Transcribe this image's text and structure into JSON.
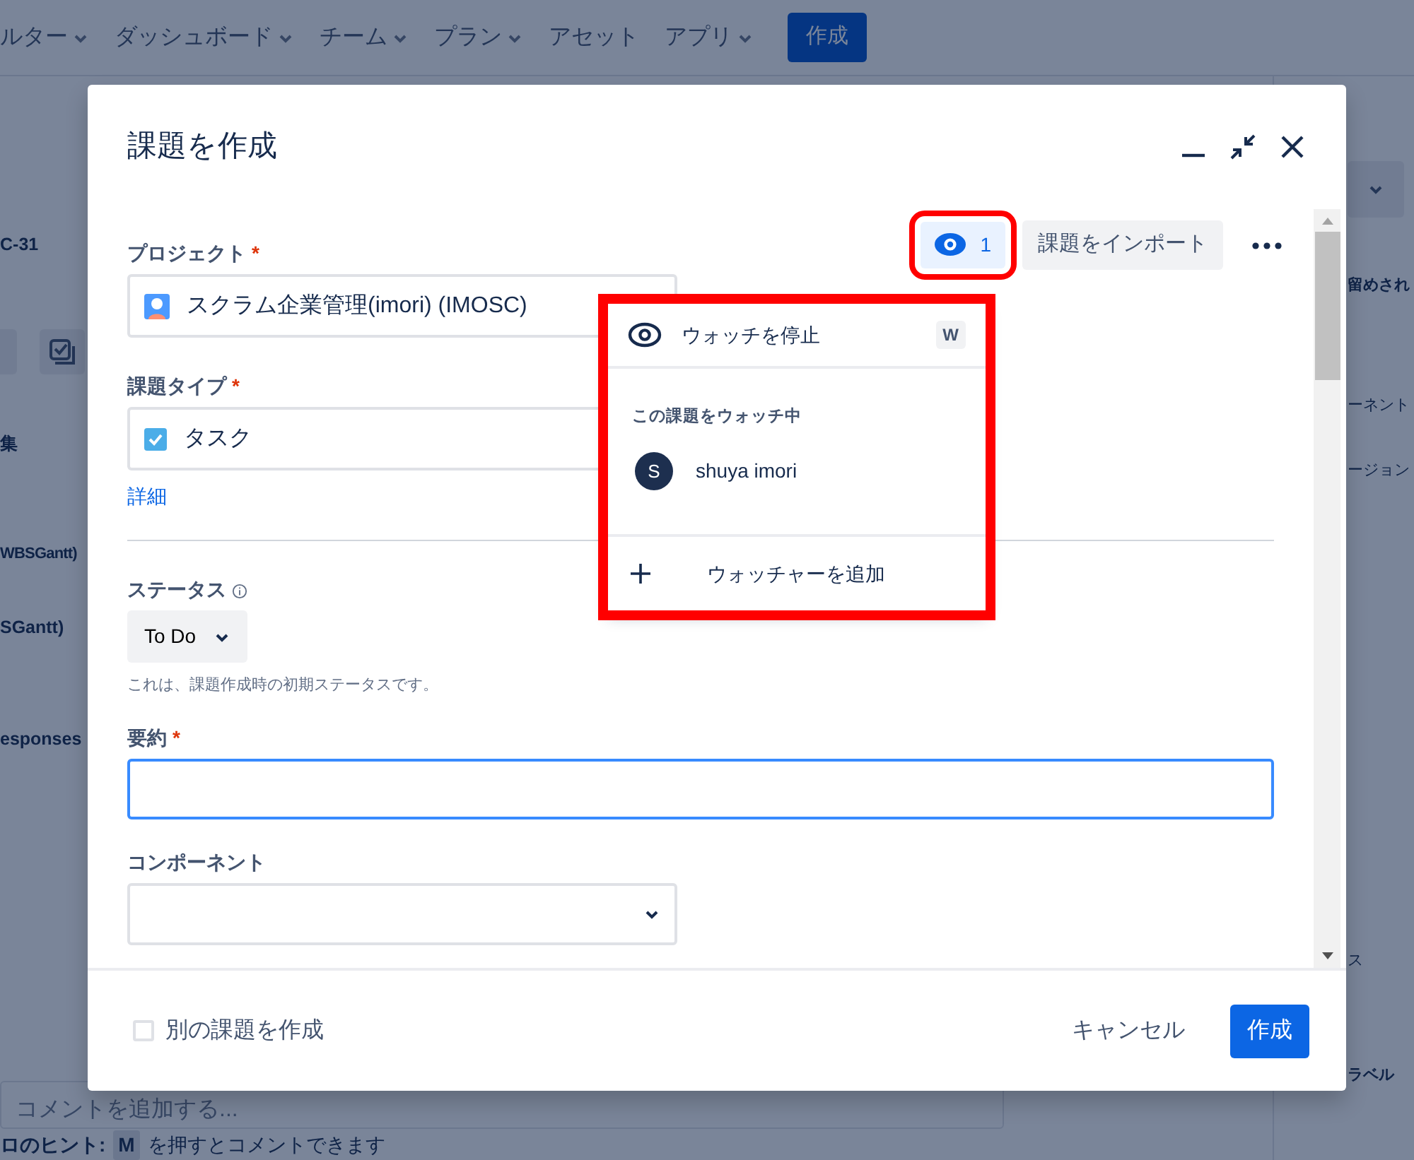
{
  "background": {
    "nav_items": [
      {
        "label": "ルター",
        "dropdown": true
      },
      {
        "label": "ダッシュボード",
        "dropdown": true
      },
      {
        "label": "チーム",
        "dropdown": true
      },
      {
        "label": "プラン",
        "dropdown": true
      },
      {
        "label": "アセット",
        "dropdown": false
      },
      {
        "label": "アプリ",
        "dropdown": true
      }
    ],
    "create_button": "作成",
    "left_texts": [
      "C-31",
      "集",
      "WBSGantt)",
      "SGantt)",
      "esponses"
    ],
    "right_texts": [
      "留めされ",
      "ーネント",
      "ージョン",
      "ス",
      "ラベル"
    ],
    "comment_placeholder": "コメントを追加する...",
    "hint": {
      "prefix": "ロのヒント:",
      "key": "M",
      "suffix": "を押すとコメントできます"
    }
  },
  "dialog": {
    "title": "課題を作成",
    "watch_button": {
      "count": "1",
      "watching": true
    },
    "import_button": "課題をインポート",
    "fields": [
      {
        "kind": "select",
        "label": "プロジェクト",
        "required_mark": "*",
        "value": "スクラム企業管理(imori) (IMOSC)"
      },
      {
        "kind": "select",
        "label": "課題タイプ",
        "required_mark": "*",
        "value": "タスク",
        "link": "詳細"
      },
      {
        "kind": "divider"
      },
      {
        "kind": "status",
        "label": "ステータス",
        "info": true,
        "value": "To Do",
        "help": "これは、課題作成時の初期ステータスです。"
      },
      {
        "kind": "text",
        "label": "要約",
        "required_mark": "*"
      },
      {
        "kind": "dropdown",
        "label": "コンポーネント"
      }
    ],
    "footer": {
      "another": {
        "label": "別の課題を作成",
        "checked": false
      },
      "cancel": "キャンセル",
      "submit": "作成"
    }
  },
  "watch_menu": {
    "toggle": {
      "label": "ウォッチを停止",
      "shortcut": "W"
    },
    "section_title": "この課題をウォッチ中",
    "watchers": [
      {
        "initial": "S",
        "name": "shuya imori"
      }
    ],
    "add": "ウォッチャーを追加"
  }
}
